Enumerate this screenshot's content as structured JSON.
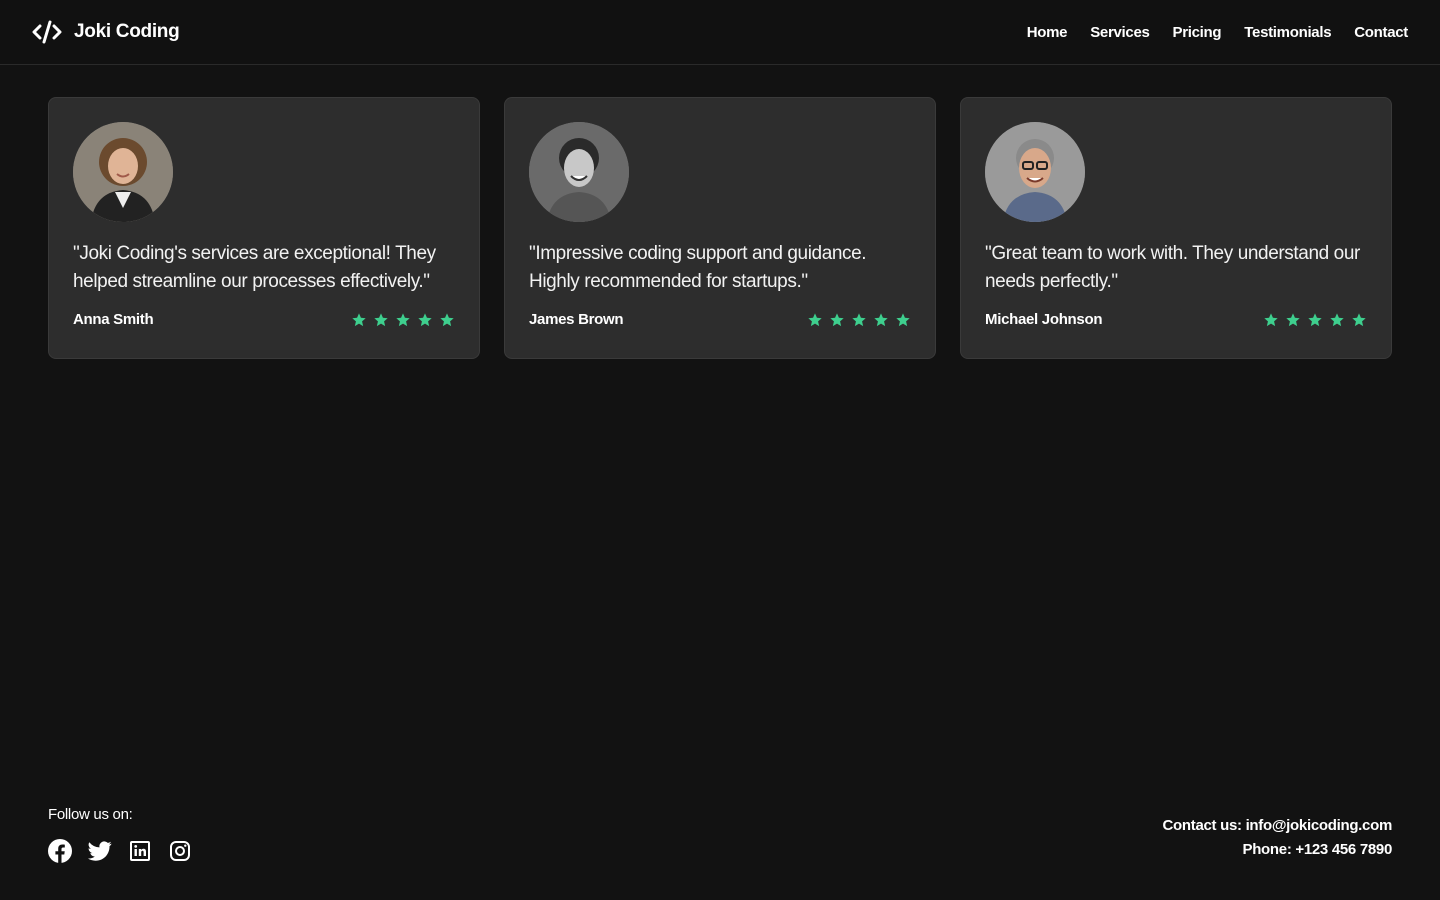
{
  "brand": {
    "name": "Joki Coding",
    "icon": "code-icon"
  },
  "nav": {
    "items": [
      {
        "label": "Home"
      },
      {
        "label": "Services"
      },
      {
        "label": "Pricing"
      },
      {
        "label": "Testimonials"
      },
      {
        "label": "Contact"
      }
    ]
  },
  "testimonials": [
    {
      "quote": "\"Joki Coding's services are exceptional! They helped streamline our processes effectively.\"",
      "author": "Anna Smith",
      "rating": 5
    },
    {
      "quote": "\"Impressive coding support and guidance. Highly recommended for startups.\"",
      "author": "James Brown",
      "rating": 5
    },
    {
      "quote": "\"Great team to work with. They understand our needs perfectly.\"",
      "author": "Michael Johnson",
      "rating": 5
    }
  ],
  "footer": {
    "follow_label": "Follow us on:",
    "socials": [
      "facebook-icon",
      "twitter-icon",
      "linkedin-icon",
      "instagram-icon"
    ],
    "contact_email": "Contact us: info@jokicoding.com",
    "contact_phone": "Phone: +123 456 7890"
  },
  "colors": {
    "background": "#121212",
    "card": "#2d2d2d",
    "star": "#3ecf8e",
    "text": "#ffffff"
  }
}
